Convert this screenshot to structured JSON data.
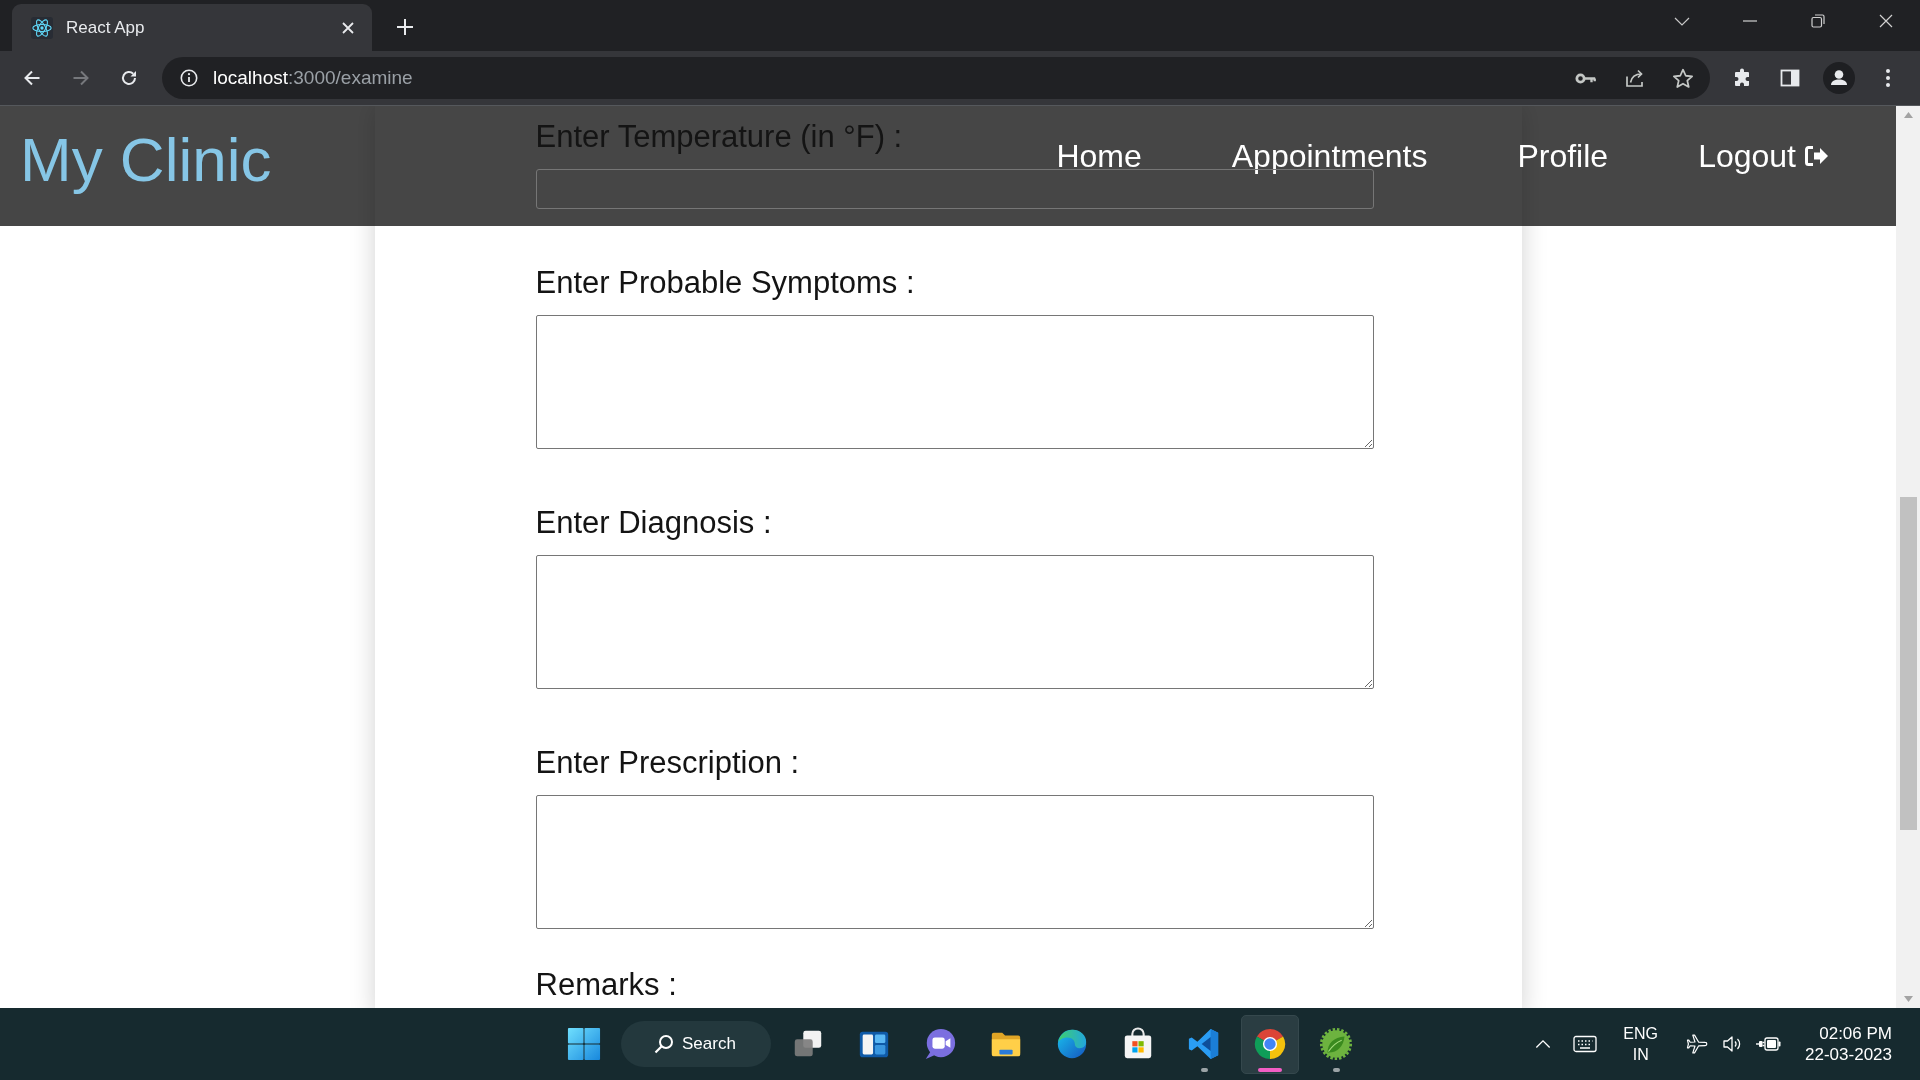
{
  "browser": {
    "tabs": [
      {
        "title": "React App",
        "selected": true
      }
    ],
    "forward_disabled": true,
    "url_host": "localhost",
    "url_rest": ":3000/examine"
  },
  "header": {
    "brand": "My Clinic",
    "nav": [
      {
        "label": "Home",
        "kind": "link"
      },
      {
        "label": "Appointments",
        "kind": "link"
      },
      {
        "label": "Profile",
        "kind": "link"
      },
      {
        "label": "Logout",
        "kind": "logout"
      }
    ]
  },
  "form": {
    "fields": [
      {
        "label": "Enter Temperature (in °F) :",
        "kind": "input"
      },
      {
        "label": "Enter Probable Symptoms :",
        "kind": "textarea"
      },
      {
        "label": "Enter Diagnosis :",
        "kind": "textarea"
      },
      {
        "label": "Enter Prescription :",
        "kind": "textarea"
      },
      {
        "label": "Remarks :",
        "kind": "label"
      }
    ]
  },
  "taskbar": {
    "search_label": "Search",
    "apps": [
      {
        "kind": "taskview",
        "running": false,
        "selected": false
      },
      {
        "kind": "widgets",
        "running": false,
        "selected": false
      },
      {
        "kind": "chat",
        "running": false,
        "selected": false
      },
      {
        "kind": "folder",
        "running": false,
        "selected": false
      },
      {
        "kind": "swirl",
        "running": false,
        "selected": false
      },
      {
        "kind": "bag",
        "running": false,
        "selected": false
      },
      {
        "kind": "ribbon",
        "running": true,
        "selected": false
      },
      {
        "kind": "orb",
        "running": true,
        "selected": true
      },
      {
        "kind": "leaf",
        "running": true,
        "selected": false
      }
    ],
    "tray": {
      "language": "ENG",
      "region": "IN",
      "time": "02:06 PM",
      "date": "22-03-2023"
    }
  }
}
